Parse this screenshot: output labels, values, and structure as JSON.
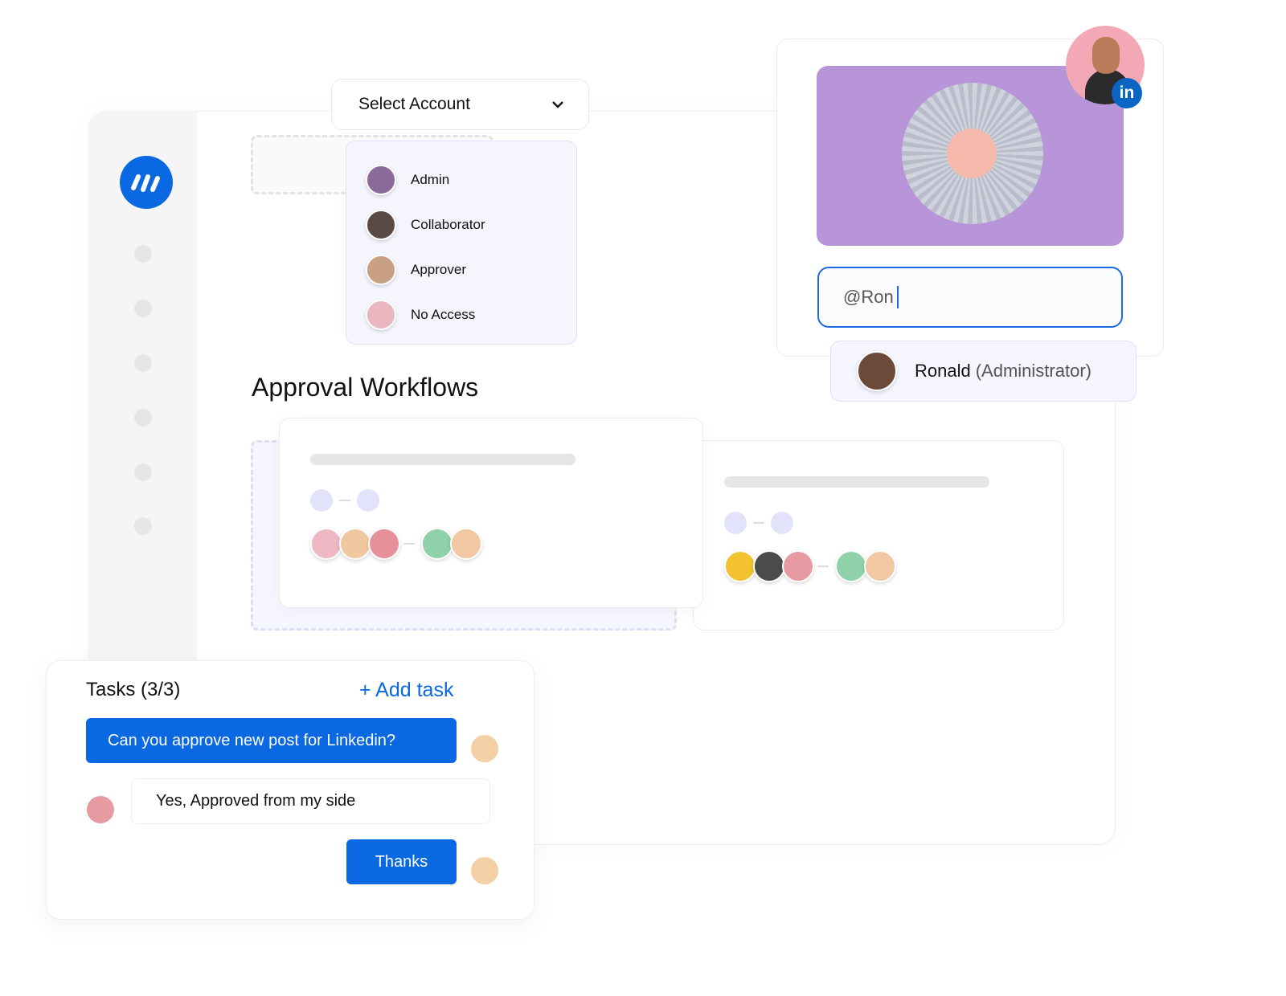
{
  "colors": {
    "accent": "#0a68e3",
    "linkedin": "#0a66c2",
    "dropdown_bg": "#f4f5fd"
  },
  "logo": {
    "icon": "three-slashes-logo"
  },
  "account_select": {
    "label": "Select Account",
    "icon": "chevron-down-icon",
    "options": [
      {
        "label": "Admin"
      },
      {
        "label": "Collaborator"
      },
      {
        "label": "Approver"
      },
      {
        "label": "No Access"
      }
    ]
  },
  "section_title": "Approval Workflows",
  "post": {
    "network": "in",
    "mention_input": "@Ron",
    "suggestion": {
      "name": "Ronald",
      "role": "(Administrator)"
    }
  },
  "tasks": {
    "title": "Tasks (3/3)",
    "add_label": "+ Add task",
    "messages": [
      {
        "text": "Can you approve new post for Linkedin?"
      },
      {
        "text": "Yes, Approved from my side"
      },
      {
        "text": "Thanks"
      }
    ]
  }
}
